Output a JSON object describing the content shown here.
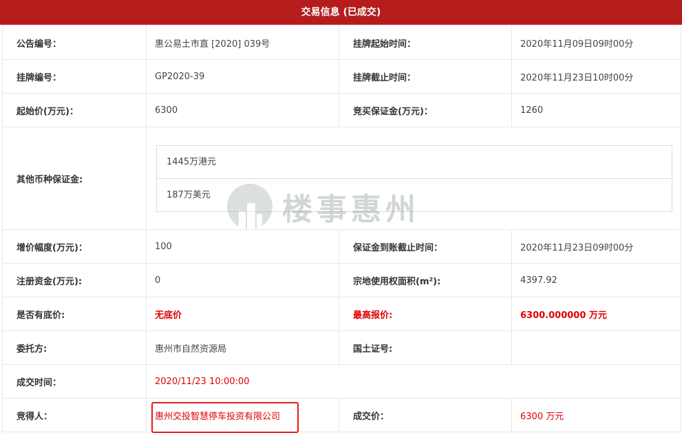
{
  "header": {
    "title": "交易信息 (已成交)"
  },
  "rows": {
    "r1": {
      "l1": "公告编号：",
      "v1": "惠公易土市直 [2020] 039号",
      "l2": "挂牌起始时间：",
      "v2": "2020年11月09日09时00分"
    },
    "r2": {
      "l1": "挂牌编号：",
      "v1": "GP2020-39",
      "l2": "挂牌截止时间：",
      "v2": "2020年11月23日10时00分"
    },
    "r3": {
      "l1": "起始价(万元)：",
      "v1": "6300",
      "l2": "竞买保证金(万元)：",
      "v2": "1260"
    },
    "r4": {
      "l1": "其他币种保证金:",
      "items": [
        "1445万港元",
        "187万美元"
      ]
    },
    "r5": {
      "l1": "增价幅度(万元)：",
      "v1": "100",
      "l2": "保证金到账截止时间：",
      "v2": "2020年11月23日09时00分"
    },
    "r6": {
      "l1": "注册资金(万元):",
      "v1": "0",
      "l2": "宗地使用权面积(m²):",
      "v2": "4397.92"
    },
    "r7": {
      "l1": "是否有底价:",
      "v1": "无底价",
      "l2": "最高报价:",
      "v2": "6300.000000 万元"
    },
    "r8": {
      "l1": "委托方:",
      "v1": "惠州市自然资源局",
      "l2": "国土证号:",
      "v2": ""
    },
    "r9": {
      "l1": "成交时间：",
      "v1": "2020/11/23 10:00:00"
    },
    "r10": {
      "l1": "竞得人：",
      "v1": "惠州交投智慧停车投资有限公司",
      "l2": "成交价：",
      "v2": "6300 万元"
    }
  },
  "watermark": {
    "text": "楼事惠州",
    "icon": "building-logo-icon"
  },
  "colors": {
    "header_bg": "#b51d1d",
    "highlight_red": "#e00000",
    "border": "#e7e7e7"
  }
}
